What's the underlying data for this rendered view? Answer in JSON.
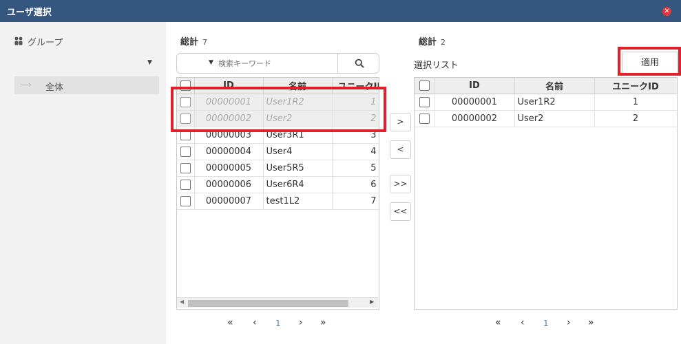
{
  "window": {
    "title": "ユーザ選択"
  },
  "left": {
    "group_label": "グループ",
    "tree_item": "全体"
  },
  "available": {
    "total_label": "総計",
    "total_count": "7",
    "search_placeholder": "検索キーワード",
    "columns": [
      "ID",
      "名前",
      "ユニークID"
    ],
    "rows": [
      {
        "id": "00000001",
        "name": "User1R2",
        "uid": "1",
        "selected": true
      },
      {
        "id": "00000002",
        "name": "User2",
        "uid": "2",
        "selected": true
      },
      {
        "id": "00000003",
        "name": "User3R1",
        "uid": "3",
        "selected": false
      },
      {
        "id": "00000004",
        "name": "User4",
        "uid": "4",
        "selected": false
      },
      {
        "id": "00000005",
        "name": "User5R5",
        "uid": "5",
        "selected": false
      },
      {
        "id": "00000006",
        "name": "User6R4",
        "uid": "6",
        "selected": false
      },
      {
        "id": "00000007",
        "name": "test1L2",
        "uid": "7",
        "selected": false
      }
    ],
    "page": "1"
  },
  "move_buttons": {
    "add": ">",
    "remove": "<",
    "add_all": ">>",
    "remove_all": "<<"
  },
  "selected": {
    "total_label": "総計",
    "total_count": "2",
    "list_label": "選択リスト",
    "apply_label": "適用",
    "columns": [
      "ID",
      "名前",
      "ユニークID"
    ],
    "rows": [
      {
        "id": "00000001",
        "name": "User1R2",
        "uid": "1"
      },
      {
        "id": "00000002",
        "name": "User2",
        "uid": "2"
      }
    ],
    "page": "1"
  },
  "pager_labels": {
    "first": "«",
    "prev": "‹",
    "next": "›",
    "last": "»"
  },
  "colors": {
    "titlebar": "#35577f",
    "highlight": "#e1212a",
    "page_active": "#3a86c4"
  }
}
